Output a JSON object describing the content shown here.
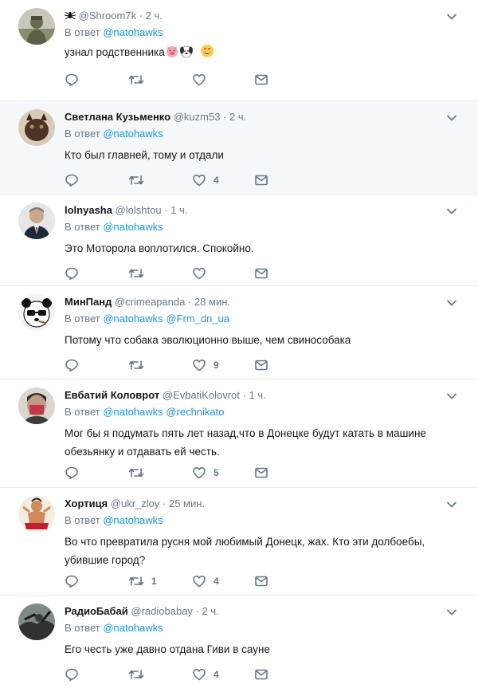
{
  "reply_prefix": "В ответ",
  "tweets": [
    {
      "name": "",
      "handle": "@Shroom7k",
      "time": "2 ч.",
      "mentions": [
        "@natohawks"
      ],
      "text": "узнал родственника",
      "emoji": [
        "pig-face",
        "dog-face",
        "grinning-face"
      ],
      "replies": "",
      "retweets": "",
      "likes": ""
    },
    {
      "name": "Светлана Кузьменко",
      "handle": "@kuzm53",
      "time": "2 ч.",
      "mentions": [
        "@natohawks"
      ],
      "text": "Кто был главней, тому и отдали",
      "replies": "",
      "retweets": "",
      "likes": "4"
    },
    {
      "name": "lolnyasha",
      "handle": "@lolshtou",
      "time": "1 ч.",
      "mentions": [
        "@natohawks"
      ],
      "text": "Это Моторола воплотился. Спокойно.",
      "replies": "",
      "retweets": "",
      "likes": ""
    },
    {
      "name": "МинПанд",
      "handle": "@crimeapanda",
      "time": "28 мин.",
      "mentions": [
        "@natohawks",
        "@Frm_dn_ua"
      ],
      "text": "Потому что собака эволюционно выше, чем свинособака",
      "replies": "",
      "retweets": "",
      "likes": "9"
    },
    {
      "name": "Евбатий Коловрот",
      "handle": "@EvbatiKolovrot",
      "time": "1 ч.",
      "mentions": [
        "@natohawks",
        "@rechnikato"
      ],
      "text_lines": [
        "Мог бы я подумать пять лет назад,что в Донецке будут катать в машине",
        "обезьянку и отдавать ей честь."
      ],
      "replies": "",
      "retweets": "",
      "likes": "5"
    },
    {
      "name": "Хортиця",
      "handle": "@ukr_zloy",
      "time": "25 мин.",
      "mentions": [
        "@natohawks"
      ],
      "text_lines": [
        "Во что превратила русня мой любимый Донецк, жах. Кто эти долбоебы,",
        "убившие город?"
      ],
      "replies": "",
      "retweets": "1",
      "likes": "4"
    },
    {
      "name": "РадиоБабай",
      "handle": "@radiobabay",
      "time": "2 ч.",
      "mentions": [
        "@natohawks"
      ],
      "text": "Его честь уже давно отдана Гиви в сауне",
      "replies": "",
      "retweets": "",
      "likes": "4"
    }
  ],
  "icons": {
    "reply": "reply-icon",
    "retweet": "retweet-icon",
    "like": "heart-icon",
    "message": "envelope-icon",
    "menu": "chevron-down-icon",
    "spider": "spider-icon"
  },
  "colors": {
    "link": "#1b95e0",
    "muted": "#657786",
    "text": "#14171a",
    "highlight_bg": "#f5f8fa",
    "divider": "#e6ecf0"
  }
}
